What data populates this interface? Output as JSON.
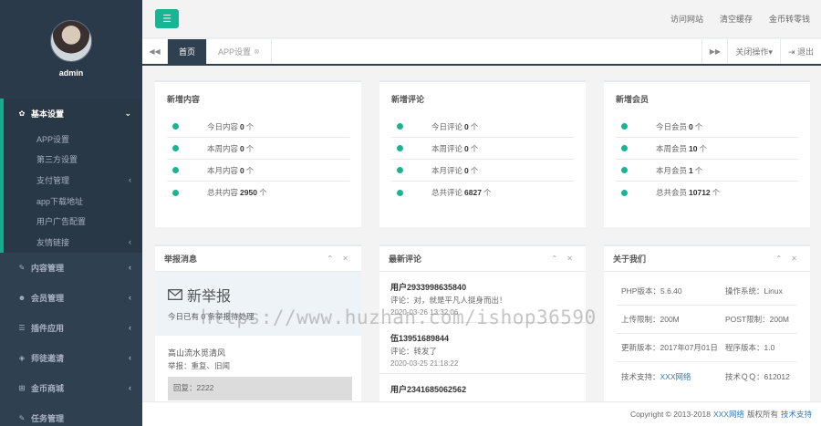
{
  "sidebar": {
    "username": "admin",
    "groups": [
      {
        "label": "基本设置",
        "icon": "gear-icon",
        "glyph": "✿",
        "arrow": "⌄"
      },
      {
        "label": "内容管理",
        "icon": "edit-icon",
        "glyph": "✎",
        "arrow": "‹"
      },
      {
        "label": "会员管理",
        "icon": "users-icon",
        "glyph": "☻",
        "arrow": "‹"
      },
      {
        "label": "插件应用",
        "icon": "list-icon",
        "glyph": "☰",
        "arrow": "‹"
      },
      {
        "label": "师徒邀请",
        "icon": "cube-icon",
        "glyph": "◈",
        "arrow": "‹"
      },
      {
        "label": "金币商城",
        "icon": "cart-icon",
        "glyph": "⊞",
        "arrow": "‹"
      },
      {
        "label": "任务管理",
        "icon": "edit-icon",
        "glyph": "✎",
        "arrow": ""
      }
    ],
    "submenu": [
      {
        "label": "APP设置",
        "arrow": ""
      },
      {
        "label": "第三方设置",
        "arrow": ""
      },
      {
        "label": "支付管理",
        "arrow": "‹"
      },
      {
        "label": "app下载地址",
        "arrow": ""
      },
      {
        "label": "用户广告配置",
        "arrow": ""
      },
      {
        "label": "友情链接",
        "arrow": "‹"
      }
    ]
  },
  "topbar": {
    "toggle_glyph": "☰",
    "links": [
      "访问网站",
      "清空缓存",
      "金币转零钱"
    ]
  },
  "tabs": {
    "prev_glyph": "◀◀",
    "next_glyph": "▶▶",
    "items": [
      {
        "label": "首页",
        "active": true
      },
      {
        "label": "APP设置",
        "active": false,
        "close": "⊗"
      }
    ],
    "close_ops": "关闭操作▾",
    "logout": "⇥ 退出"
  },
  "stats": [
    {
      "title": "新增内容",
      "rows": [
        {
          "pre": "今日内容",
          "val": "0",
          "unit": "个"
        },
        {
          "pre": "本周内容",
          "val": "0",
          "unit": "个"
        },
        {
          "pre": "本月内容",
          "val": "0",
          "unit": "个"
        },
        {
          "pre": "总共内容",
          "val": "2950",
          "unit": "个"
        }
      ]
    },
    {
      "title": "新增评论",
      "rows": [
        {
          "pre": "今日评论",
          "val": "0",
          "unit": "个"
        },
        {
          "pre": "本周评论",
          "val": "0",
          "unit": "个"
        },
        {
          "pre": "本月评论",
          "val": "0",
          "unit": "个"
        },
        {
          "pre": "总共评论",
          "val": "6827",
          "unit": "个"
        }
      ]
    },
    {
      "title": "新增会员",
      "rows": [
        {
          "pre": "今日会员",
          "val": "0",
          "unit": "个"
        },
        {
          "pre": "本周会员",
          "val": "10",
          "unit": "个"
        },
        {
          "pre": "本月会员",
          "val": "1",
          "unit": "个"
        },
        {
          "pre": "总共会员",
          "val": "10712",
          "unit": "个"
        }
      ]
    }
  ],
  "report": {
    "title": "举报消息",
    "tools": "⌃ ✕",
    "head_title": "新举报",
    "head_sub": "今日已有 0 条举报待处理",
    "item_title": "高山流水觅清风",
    "item_sub": "举报：重复、旧闻",
    "reply": "回复：2222"
  },
  "comments": {
    "title": "最新评论",
    "tools": "⌃ ✕",
    "items": [
      {
        "user": "用户2933998635840",
        "text": "评论：对，就是平凡人挺身而出！",
        "date": "2020-03-26 13:32:06"
      },
      {
        "user": "伍13951689844",
        "text": "评论：转发了",
        "date": "2020-03-25 21:18:22"
      },
      {
        "user": "用户2341685062562",
        "text": "",
        "date": ""
      }
    ]
  },
  "about": {
    "title": "关于我们",
    "tools": "⌃ ✕",
    "rows": [
      {
        "c1": "PHP版本：5.6.40",
        "c2": "操作系统：Linux"
      },
      {
        "c1": "上传限制：200M",
        "c2": "POST限制：200M"
      },
      {
        "c1": "更新版本：2017年07月01日",
        "c2": "程序版本：1.0"
      },
      {
        "c1_pre": "技术支持：",
        "c1_link": "XXX网络",
        "c2": "技术ＱＱ：612012"
      }
    ]
  },
  "footer": {
    "pre": "Copyright © 2013-2018",
    "company": "XXX网络",
    "mid": "版权所有",
    "support": "技术支持"
  },
  "watermark": "https://www.huzhan.com/ishop36590"
}
